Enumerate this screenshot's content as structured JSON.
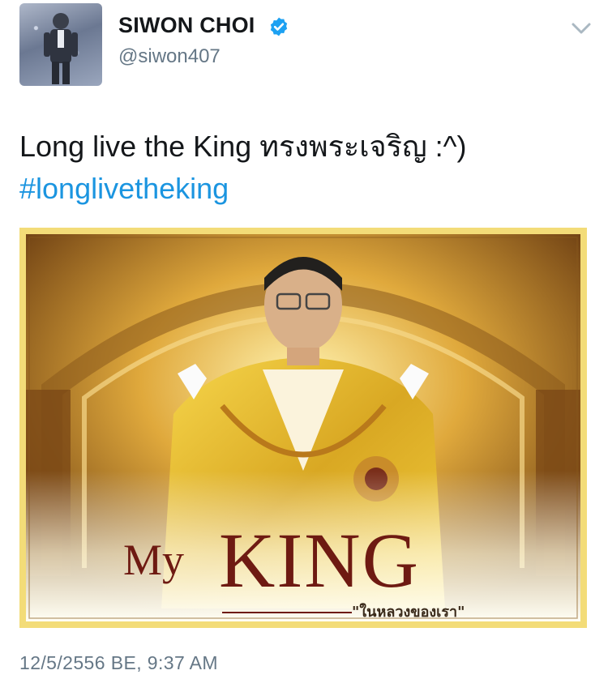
{
  "author": {
    "display_name": "SIWON CHOI",
    "handle": "@siwon407",
    "verified": true,
    "verified_icon": "verified-badge-icon",
    "avatar_icon": "avatar"
  },
  "menu": {
    "icon": "chevron-down-icon"
  },
  "tweet": {
    "text": "Long live the King ทรงพระเจริญ :^)",
    "hashtag": "#longlivetheking"
  },
  "media": {
    "title_word1": "My",
    "title_word2": "KING",
    "caption": "\"ในหลวงของเรา\""
  },
  "timestamp": "12/5/2556 BE, 9:37 AM",
  "colors": {
    "text": "#14171a",
    "secondary": "#657786",
    "link": "#1b95e0",
    "verified": "#1da1f2",
    "gold": "#e8c24a",
    "title_red": "#6e1a12"
  }
}
